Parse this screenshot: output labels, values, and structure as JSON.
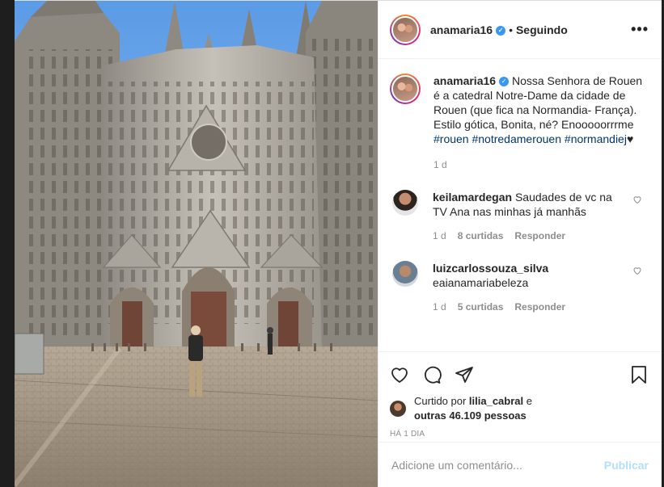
{
  "post": {
    "username": "anamaria16",
    "verified_mark": "✓",
    "dot": "•",
    "following": "Seguindo",
    "more_icon": "•••",
    "photo_icon": "rouen-cathedral-photo"
  },
  "caption": {
    "username": "anamaria16",
    "text": "Nossa Senhora de Rouen é a catedral Notre-Dame da cidade de Rouen (que fica na Normandia- França). Estilo gótica, Bonita, né? Enooooorrrme ",
    "hashtag1": "#rouen",
    "hashtag2": "#notredamerouen",
    "hashtag3": "#normandiej",
    "suffix": "♥",
    "age": "1 d"
  },
  "comments": [
    {
      "username": "keilamardegan",
      "text": "Saudades de vc na TV Ana nas minhas já manhãs",
      "age": "1 d",
      "likes": "8 curtidas",
      "reply": "Responder"
    },
    {
      "username": "luizcarlossouza_silva",
      "text": "eaianamariabeleza",
      "age": "1 d",
      "likes": "5 curtidas",
      "reply": "Responder"
    }
  ],
  "likes": {
    "prefix": "Curtido por ",
    "user": "lilia_cabral",
    "middle": " e",
    "others": "outras 46.109 pessoas"
  },
  "time_ago": "HÁ 1 DIA",
  "comment_box": {
    "placeholder": "Adicione um comentário...",
    "post_label": "Publicar"
  },
  "colors": {
    "link": "#00376b",
    "verified": "#3897f0",
    "publish_disabled": "#b2dffc",
    "muted": "#8e8e8e"
  }
}
